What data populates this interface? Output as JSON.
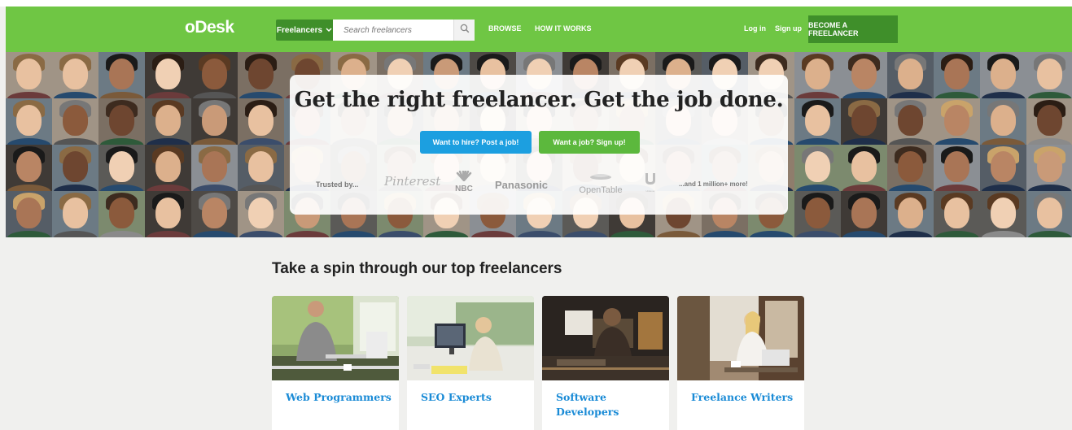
{
  "header": {
    "logo": "oDesk",
    "category_dropdown": "Freelancers",
    "search_placeholder": "Search freelancers",
    "nav": [
      "BROWSE",
      "HOW IT WORKS"
    ],
    "login": "Log in",
    "signup": "Sign up",
    "become_cta": "BECOME A FREELANCER",
    "brand_color": "#6fc644"
  },
  "hero": {
    "title": "Get the right freelancer. Get the job done.",
    "hire_button": "Want to hire? Post a job!",
    "job_button": "Want a job? Sign up!",
    "trusted_label": "Trusted by...",
    "brands": [
      "Pinterest",
      "NBC",
      "Panasonic",
      "OpenTable",
      "Unilever"
    ],
    "more_label": "...and 1 million+ more!",
    "hire_color": "#1c9fe0",
    "job_color": "#5cb83d"
  },
  "section": {
    "title": "Take a spin through our top freelancers",
    "cards": [
      {
        "label": "Web Programmers"
      },
      {
        "label": "SEO Experts"
      },
      {
        "label": "Software Developers"
      },
      {
        "label": "Freelance Writers"
      }
    ]
  }
}
